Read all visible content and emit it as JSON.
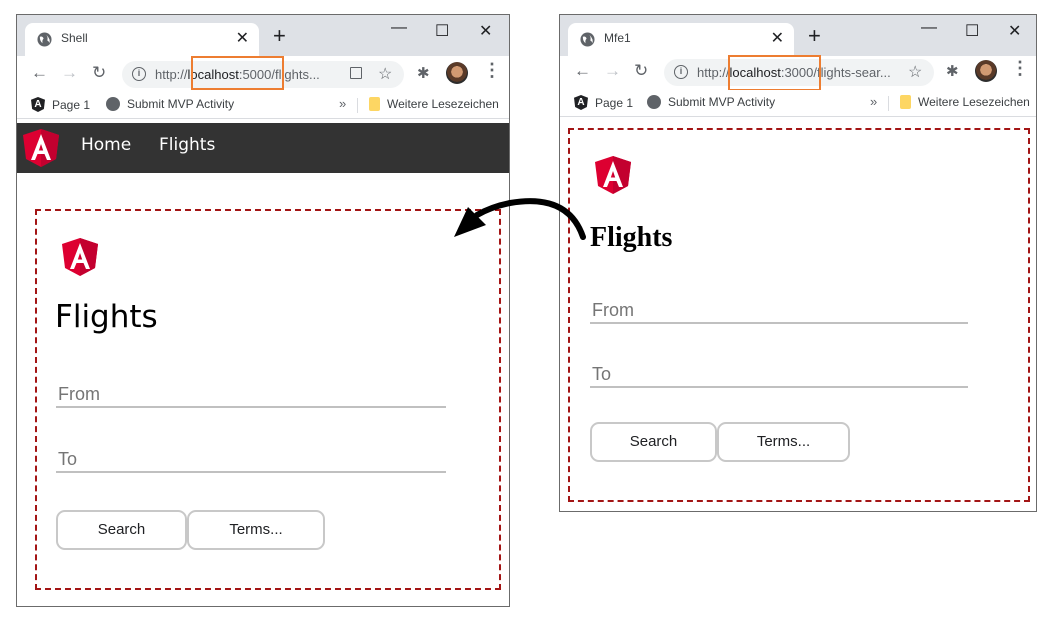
{
  "windows": {
    "shell": {
      "tab_title": "Shell",
      "tab_icon": "globe-icon",
      "url_prefix": "http://",
      "url_host": "localhost",
      "url_port": ":5000",
      "url_rest": "/flights...",
      "bookmarks": [
        {
          "label": "Page 1",
          "icon": "angular-icon"
        },
        {
          "label": "Submit MVP Activity",
          "icon": "globe-icon"
        }
      ],
      "bookmarks_more": "»",
      "other_bookmarks": "Weitere Lesezeichen",
      "app_nav": [
        {
          "label": "Home"
        },
        {
          "label": "Flights"
        }
      ],
      "remote": {
        "title": "Flights",
        "from_placeholder": "From",
        "to_placeholder": "To",
        "search_label": "Search",
        "terms_label": "Terms..."
      }
    },
    "mfe1": {
      "tab_title": "Mfe1",
      "tab_icon": "globe-icon",
      "url_prefix": "http://",
      "url_host": "localhost",
      "url_port": ":3000",
      "url_rest": "/flights-sear...",
      "bookmarks": [
        {
          "label": "Page 1",
          "icon": "angular-icon"
        },
        {
          "label": "Submit MVP Activity",
          "icon": "globe-icon"
        }
      ],
      "bookmarks_more": "»",
      "other_bookmarks": "Weitere Lesezeichen",
      "remote": {
        "title": "Flights",
        "from_placeholder": "From",
        "to_placeholder": "To",
        "search_label": "Search",
        "terms_label": "Terms..."
      }
    }
  },
  "glyphs": {
    "close": "✕",
    "new_tab": "+",
    "minimize": "—",
    "maximize": "☐",
    "window_close": "✕",
    "back": "←",
    "forward": "→",
    "reload": "↻",
    "star": "☆",
    "info": "i",
    "extensions": "✱",
    "menu": "⋮",
    "angular_letter": "A"
  },
  "colors": {
    "highlight": "#ed7d31",
    "dashed_border": "#a31515",
    "app_nav_bg": "#333333",
    "angular_red": "#dd0031"
  }
}
